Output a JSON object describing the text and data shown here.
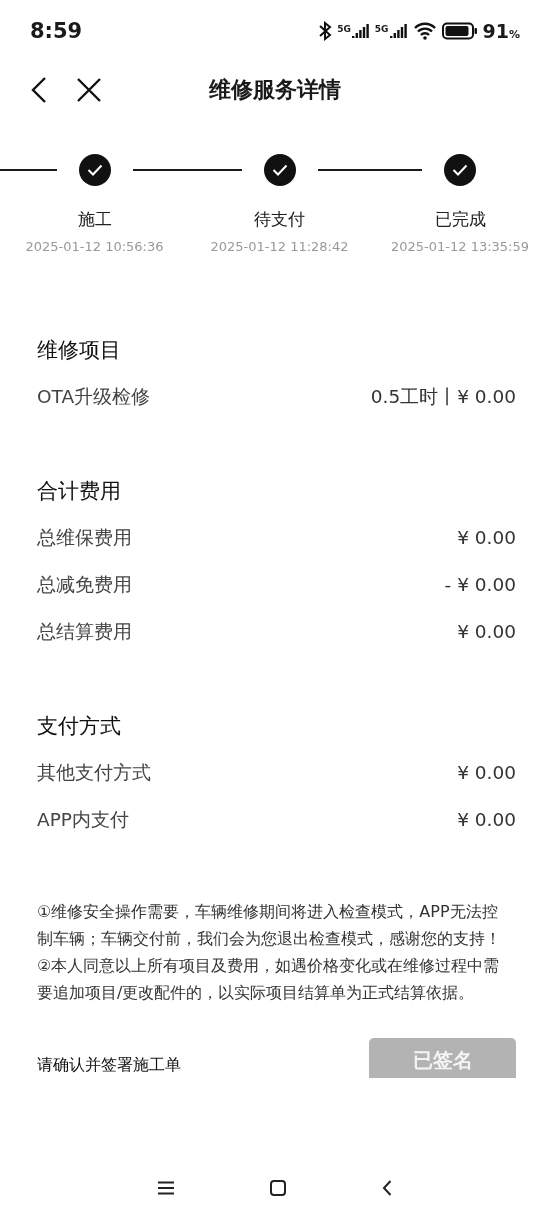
{
  "status_bar": {
    "time": "8:59",
    "sims": [
      {
        "network": "5G"
      },
      {
        "network": "5G"
      }
    ],
    "battery": "91",
    "battery_unit": "%"
  },
  "header": {
    "title": "维修服务详情"
  },
  "steps": [
    {
      "label": "施工",
      "time": "2025-01-12 10:56:36",
      "done": true
    },
    {
      "label": "待支付",
      "time": "2025-01-12 11:28:42",
      "done": true
    },
    {
      "label": "已完成",
      "time": "2025-01-12 13:35:59",
      "done": true
    }
  ],
  "sections": [
    {
      "title": "维修项目",
      "rows": [
        {
          "label": "OTA升级检修",
          "value": "0.5工时丨¥ 0.00"
        }
      ]
    },
    {
      "title": "合计费用",
      "rows": [
        {
          "label": "总维保费用",
          "value": "¥ 0.00"
        },
        {
          "label": "总减免费用",
          "value": "- ¥ 0.00"
        },
        {
          "label": "总结算费用",
          "value": "¥ 0.00"
        }
      ]
    },
    {
      "title": "支付方式",
      "rows": [
        {
          "label": "其他支付方式",
          "value": "¥ 0.00"
        },
        {
          "label": "APP内支付",
          "value": "¥ 0.00"
        }
      ]
    }
  ],
  "notes": [
    "①维修安全操作需要，车辆维修期间将进入检查模式，APP无法控制车辆；车辆交付前，我们会为您退出检查模式，感谢您的支持！",
    "②本人同意以上所有项目及费用，如遇价格变化或在维修过程中需要追加项目/更改配件的，以实际项目结算单为正式结算依据。"
  ],
  "sign": {
    "prompt": "请确认并签署施工单",
    "button": "已签名",
    "disabled": true
  }
}
